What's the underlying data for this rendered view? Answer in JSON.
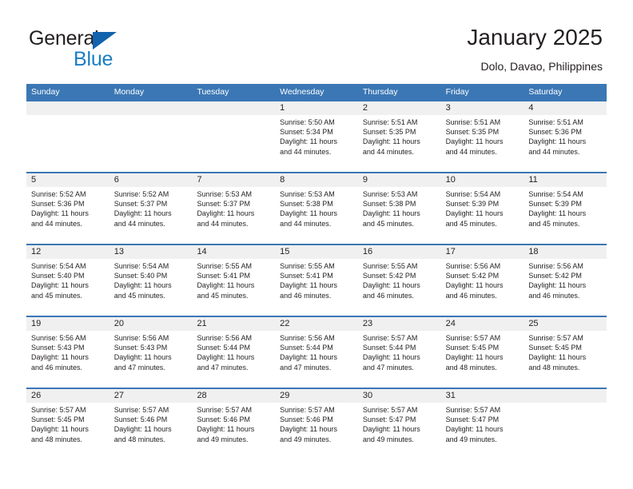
{
  "brand": {
    "name_dark": "General",
    "name_light": "Blue",
    "triangle_color": "#1262ad",
    "blue_color": "#1b7dc4"
  },
  "header": {
    "title": "January 2025",
    "location": "Dolo, Davao, Philippines"
  },
  "theme": {
    "header_blue": "#3b77b5",
    "daynum_strip": "#f0f0f0",
    "text": "#231f20"
  },
  "weekdays": [
    "Sunday",
    "Monday",
    "Tuesday",
    "Wednesday",
    "Thursday",
    "Friday",
    "Saturday"
  ],
  "weeks": [
    [
      {
        "day": "",
        "empty": true
      },
      {
        "day": "",
        "empty": true
      },
      {
        "day": "",
        "empty": true
      },
      {
        "day": "1",
        "sunrise": "Sunrise: 5:50 AM",
        "sunset": "Sunset: 5:34 PM",
        "daylight1": "Daylight: 11 hours",
        "daylight2": "and 44 minutes."
      },
      {
        "day": "2",
        "sunrise": "Sunrise: 5:51 AM",
        "sunset": "Sunset: 5:35 PM",
        "daylight1": "Daylight: 11 hours",
        "daylight2": "and 44 minutes."
      },
      {
        "day": "3",
        "sunrise": "Sunrise: 5:51 AM",
        "sunset": "Sunset: 5:35 PM",
        "daylight1": "Daylight: 11 hours",
        "daylight2": "and 44 minutes."
      },
      {
        "day": "4",
        "sunrise": "Sunrise: 5:51 AM",
        "sunset": "Sunset: 5:36 PM",
        "daylight1": "Daylight: 11 hours",
        "daylight2": "and 44 minutes."
      }
    ],
    [
      {
        "day": "5",
        "sunrise": "Sunrise: 5:52 AM",
        "sunset": "Sunset: 5:36 PM",
        "daylight1": "Daylight: 11 hours",
        "daylight2": "and 44 minutes."
      },
      {
        "day": "6",
        "sunrise": "Sunrise: 5:52 AM",
        "sunset": "Sunset: 5:37 PM",
        "daylight1": "Daylight: 11 hours",
        "daylight2": "and 44 minutes."
      },
      {
        "day": "7",
        "sunrise": "Sunrise: 5:53 AM",
        "sunset": "Sunset: 5:37 PM",
        "daylight1": "Daylight: 11 hours",
        "daylight2": "and 44 minutes."
      },
      {
        "day": "8",
        "sunrise": "Sunrise: 5:53 AM",
        "sunset": "Sunset: 5:38 PM",
        "daylight1": "Daylight: 11 hours",
        "daylight2": "and 44 minutes."
      },
      {
        "day": "9",
        "sunrise": "Sunrise: 5:53 AM",
        "sunset": "Sunset: 5:38 PM",
        "daylight1": "Daylight: 11 hours",
        "daylight2": "and 45 minutes."
      },
      {
        "day": "10",
        "sunrise": "Sunrise: 5:54 AM",
        "sunset": "Sunset: 5:39 PM",
        "daylight1": "Daylight: 11 hours",
        "daylight2": "and 45 minutes."
      },
      {
        "day": "11",
        "sunrise": "Sunrise: 5:54 AM",
        "sunset": "Sunset: 5:39 PM",
        "daylight1": "Daylight: 11 hours",
        "daylight2": "and 45 minutes."
      }
    ],
    [
      {
        "day": "12",
        "sunrise": "Sunrise: 5:54 AM",
        "sunset": "Sunset: 5:40 PM",
        "daylight1": "Daylight: 11 hours",
        "daylight2": "and 45 minutes."
      },
      {
        "day": "13",
        "sunrise": "Sunrise: 5:54 AM",
        "sunset": "Sunset: 5:40 PM",
        "daylight1": "Daylight: 11 hours",
        "daylight2": "and 45 minutes."
      },
      {
        "day": "14",
        "sunrise": "Sunrise: 5:55 AM",
        "sunset": "Sunset: 5:41 PM",
        "daylight1": "Daylight: 11 hours",
        "daylight2": "and 45 minutes."
      },
      {
        "day": "15",
        "sunrise": "Sunrise: 5:55 AM",
        "sunset": "Sunset: 5:41 PM",
        "daylight1": "Daylight: 11 hours",
        "daylight2": "and 46 minutes."
      },
      {
        "day": "16",
        "sunrise": "Sunrise: 5:55 AM",
        "sunset": "Sunset: 5:42 PM",
        "daylight1": "Daylight: 11 hours",
        "daylight2": "and 46 minutes."
      },
      {
        "day": "17",
        "sunrise": "Sunrise: 5:56 AM",
        "sunset": "Sunset: 5:42 PM",
        "daylight1": "Daylight: 11 hours",
        "daylight2": "and 46 minutes."
      },
      {
        "day": "18",
        "sunrise": "Sunrise: 5:56 AM",
        "sunset": "Sunset: 5:42 PM",
        "daylight1": "Daylight: 11 hours",
        "daylight2": "and 46 minutes."
      }
    ],
    [
      {
        "day": "19",
        "sunrise": "Sunrise: 5:56 AM",
        "sunset": "Sunset: 5:43 PM",
        "daylight1": "Daylight: 11 hours",
        "daylight2": "and 46 minutes."
      },
      {
        "day": "20",
        "sunrise": "Sunrise: 5:56 AM",
        "sunset": "Sunset: 5:43 PM",
        "daylight1": "Daylight: 11 hours",
        "daylight2": "and 47 minutes."
      },
      {
        "day": "21",
        "sunrise": "Sunrise: 5:56 AM",
        "sunset": "Sunset: 5:44 PM",
        "daylight1": "Daylight: 11 hours",
        "daylight2": "and 47 minutes."
      },
      {
        "day": "22",
        "sunrise": "Sunrise: 5:56 AM",
        "sunset": "Sunset: 5:44 PM",
        "daylight1": "Daylight: 11 hours",
        "daylight2": "and 47 minutes."
      },
      {
        "day": "23",
        "sunrise": "Sunrise: 5:57 AM",
        "sunset": "Sunset: 5:44 PM",
        "daylight1": "Daylight: 11 hours",
        "daylight2": "and 47 minutes."
      },
      {
        "day": "24",
        "sunrise": "Sunrise: 5:57 AM",
        "sunset": "Sunset: 5:45 PM",
        "daylight1": "Daylight: 11 hours",
        "daylight2": "and 48 minutes."
      },
      {
        "day": "25",
        "sunrise": "Sunrise: 5:57 AM",
        "sunset": "Sunset: 5:45 PM",
        "daylight1": "Daylight: 11 hours",
        "daylight2": "and 48 minutes."
      }
    ],
    [
      {
        "day": "26",
        "sunrise": "Sunrise: 5:57 AM",
        "sunset": "Sunset: 5:45 PM",
        "daylight1": "Daylight: 11 hours",
        "daylight2": "and 48 minutes."
      },
      {
        "day": "27",
        "sunrise": "Sunrise: 5:57 AM",
        "sunset": "Sunset: 5:46 PM",
        "daylight1": "Daylight: 11 hours",
        "daylight2": "and 48 minutes."
      },
      {
        "day": "28",
        "sunrise": "Sunrise: 5:57 AM",
        "sunset": "Sunset: 5:46 PM",
        "daylight1": "Daylight: 11 hours",
        "daylight2": "and 49 minutes."
      },
      {
        "day": "29",
        "sunrise": "Sunrise: 5:57 AM",
        "sunset": "Sunset: 5:46 PM",
        "daylight1": "Daylight: 11 hours",
        "daylight2": "and 49 minutes."
      },
      {
        "day": "30",
        "sunrise": "Sunrise: 5:57 AM",
        "sunset": "Sunset: 5:47 PM",
        "daylight1": "Daylight: 11 hours",
        "daylight2": "and 49 minutes."
      },
      {
        "day": "31",
        "sunrise": "Sunrise: 5:57 AM",
        "sunset": "Sunset: 5:47 PM",
        "daylight1": "Daylight: 11 hours",
        "daylight2": "and 49 minutes."
      },
      {
        "day": "",
        "empty": true
      }
    ]
  ]
}
